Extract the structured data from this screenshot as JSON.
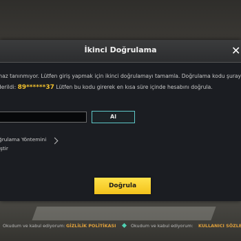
{
  "dialog": {
    "title": "İkinci Doğrulama",
    "close_label": "✕",
    "message_line1": "cihaz tanınmıyor. Lütfen giriş yapmak için ikinci doğrulamayı tamamla. Doğrulama kodu şuray",
    "message_line2_prefix": "nderildi: ",
    "phone_masked": "89******37",
    "message_line2_suffix": " Lütfen bu kodu girerek en kısa süre içinde hesabını doğrula.",
    "code_input": {
      "value": "",
      "placeholder": ""
    },
    "send_button_label": "Al",
    "change_method_line1": "ğrulama Yöntemini",
    "change_method_line2": "iştir",
    "verify_button_label": "Doğrula"
  },
  "footer": {
    "text1": "Okudum ve kabul ediyorum:",
    "link1": "GİZLİLİK POLİTİKASI",
    "text2": "Okudum ve kabul ediyorum:",
    "link2": "KULLANICI SÖZLEŞME"
  },
  "colors": {
    "accent_yellow": "#f2c12e",
    "teal_border": "#5fc9c9",
    "link_orange": "#e0a13c"
  }
}
